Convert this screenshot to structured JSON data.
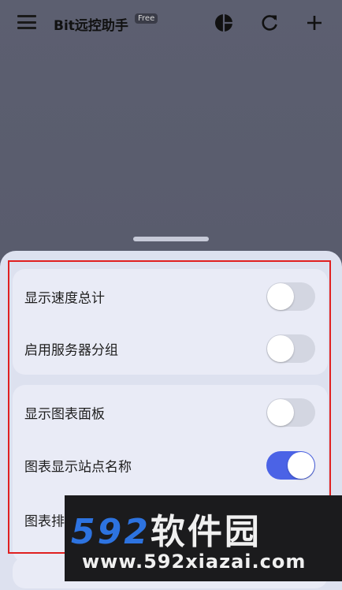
{
  "app": {
    "title": "Bit远控助手",
    "badge": "Free"
  },
  "toolbar_icons": [
    "pie-chart-icon",
    "refresh-icon",
    "plus-icon"
  ],
  "settings": {
    "card1": [
      {
        "label": "显示速度总计",
        "enabled": false
      },
      {
        "label": "启用服务器分组",
        "enabled": false
      }
    ],
    "card2": [
      {
        "label": "显示图表面板",
        "enabled": false
      },
      {
        "label": "图表显示站点名称",
        "enabled": true
      },
      {
        "label": "图表排",
        "enabled": false
      }
    ]
  },
  "watermark": {
    "numbers": "592",
    "chinese": "软件园",
    "url": "www.592xiazai.com"
  },
  "colors": {
    "accent": "#4b63e6",
    "highlight_border": "#e02020",
    "watermark_blue": "#2d73e0"
  }
}
